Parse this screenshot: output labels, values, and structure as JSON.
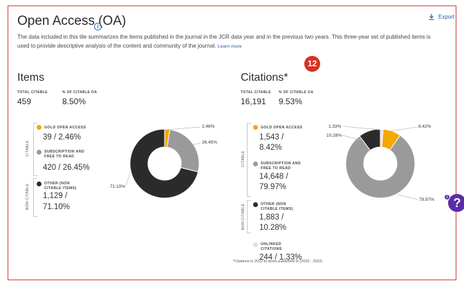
{
  "panel": {
    "title": "Open Access (OA)",
    "export_label": "Export",
    "description": "The data included in this tile summarizes the items published in the journal in the JCR data year and in the previous two years. This three-year set of published items is used to provide descriptive analysis of the content and community of the journal.",
    "learn_more": "Learn more"
  },
  "items": {
    "title": "Items",
    "total_citable_label": "TOTAL CITABLE",
    "total_citable": "459",
    "pct_oa_label": "% OF CITABLE OA",
    "pct_oa": "8.50%",
    "citable_label": "CITABLE",
    "non_citable_label": "NON-CITABLE",
    "legend": [
      {
        "label": "GOLD OPEN ACCESS",
        "value": "39 / 2.46%",
        "color": "#f5a800"
      },
      {
        "label": "SUBSCRIPTION AND FREE TO READ",
        "value": "420 / 26.45%",
        "color": "#9a9a9a"
      },
      {
        "label": "OTHER (NON CITABLE ITEMS)",
        "value_line1": "1,129 /",
        "value_line2": "71.10%",
        "color": "#2b2b2b"
      }
    ],
    "chart_labels": {
      "gold": "2.46%",
      "sub": "26.45%",
      "other": "71.10%"
    }
  },
  "citations": {
    "title": "Citations*",
    "total_citable_label": "TOTAL CITABLE",
    "total_citable": "16,191",
    "pct_oa_label": "% OF CITABLE OA",
    "pct_oa": "9.53%",
    "citable_label": "CITABLE",
    "non_citable_label": "NON-CITABLE",
    "legend": [
      {
        "label": "GOLD OPEN ACCESS",
        "value_line1": "1,543 /",
        "value_line2": "8.42%",
        "color": "#f5a800"
      },
      {
        "label_line1": "SUBSCRIPTION AND",
        "label_line2": "FREE TO READ",
        "value_line1": "14,648 /",
        "value_line2": "79.97%",
        "color": "#9a9a9a"
      },
      {
        "label_line1": "OTHER (NON",
        "label_line2": "CITABLE ITEMS)",
        "value_line1": "1,883 /",
        "value_line2": "10.28%",
        "color": "#2b2b2b"
      },
      {
        "label_line1": "UNLINKED",
        "label_line2": "CITATIONS",
        "value": "244 / 1.33%",
        "color": "#e0e0e0"
      }
    ],
    "chart_labels": {
      "unlinked": "1.33%",
      "other": "10.28%",
      "gold": "8.42%",
      "sub": "79.97%"
    },
    "footnote": "*Citations in 2022 to items published in (2020 - 2022)"
  },
  "badges": {
    "step_number": "12",
    "help_symbol": "?",
    "help_count": "2"
  },
  "chart_data": [
    {
      "type": "pie",
      "title": "Items",
      "categories": [
        "Gold Open Access",
        "Subscription and Free to Read",
        "Other (Non Citable Items)"
      ],
      "values": [
        2.46,
        26.45,
        71.1
      ],
      "colors": [
        "#f5a800",
        "#9a9a9a",
        "#2b2b2b"
      ]
    },
    {
      "type": "pie",
      "title": "Citations*",
      "categories": [
        "Unlinked Citations",
        "Gold Open Access",
        "Subscription and Free to Read",
        "Other (Non Citable Items)"
      ],
      "values": [
        1.33,
        8.42,
        79.97,
        10.28
      ],
      "colors": [
        "#e0e0e0",
        "#f5a800",
        "#9a9a9a",
        "#2b2b2b"
      ]
    }
  ]
}
